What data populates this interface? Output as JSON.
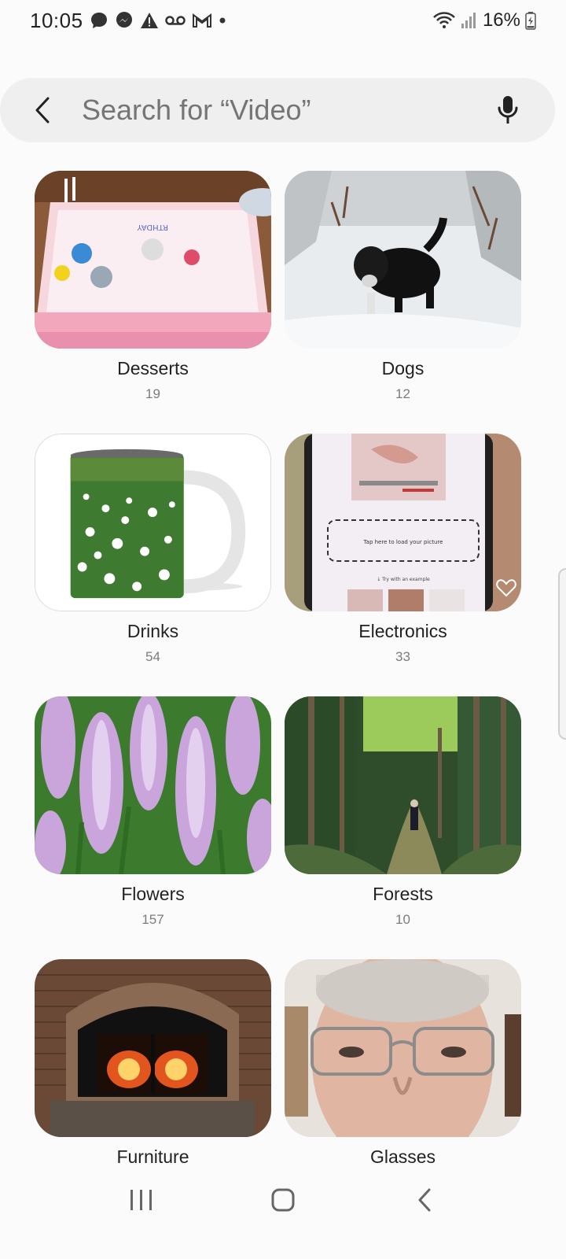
{
  "status_bar": {
    "time": "10:05",
    "battery": "16%",
    "left_icons": [
      "message-icon",
      "messenger-icon",
      "alert-icon",
      "voicemail-icon",
      "gmail-icon",
      "dot-icon"
    ],
    "right_icons": [
      "wifi-icon",
      "signal-icon",
      "battery-icon"
    ]
  },
  "search": {
    "placeholder": "Search for “Video”"
  },
  "categories": [
    {
      "label": "Desserts",
      "count": "19"
    },
    {
      "label": "Dogs",
      "count": "12"
    },
    {
      "label": "Drinks",
      "count": "54"
    },
    {
      "label": "Electronics",
      "count": "33"
    },
    {
      "label": "Flowers",
      "count": "157"
    },
    {
      "label": "Forests",
      "count": "10"
    },
    {
      "label": "Furniture",
      "count": ""
    },
    {
      "label": "Glasses",
      "count": ""
    }
  ],
  "electronics_photo_text": {
    "line1": "Tap here to load your picture",
    "line2": "↓ Try with an example"
  },
  "colors": {
    "accent": "#202020",
    "search_bg": "#efefef",
    "count_text": "#7c7c7c"
  }
}
